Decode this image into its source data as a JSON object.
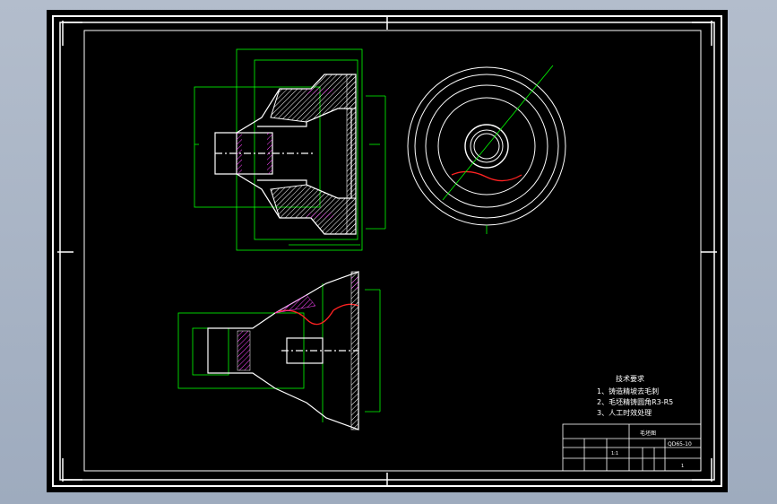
{
  "drawing": {
    "tech_requirements": {
      "heading": "技术要求",
      "items": [
        "1、铸造精坡去毛刺",
        "2、毛坯精铸圆角R3-R5",
        "3、人工时效处理"
      ]
    },
    "title_block": {
      "part_name": "毛坯图",
      "drawing_no": "QD65-10",
      "scale_label": "1:1",
      "sheet_label": "1"
    },
    "colors": {
      "background": "#000000",
      "lines": "#ffffff",
      "dimensions": "#00ff00",
      "hatch": "#ff00ff",
      "break_lines": "#ff2222"
    }
  }
}
